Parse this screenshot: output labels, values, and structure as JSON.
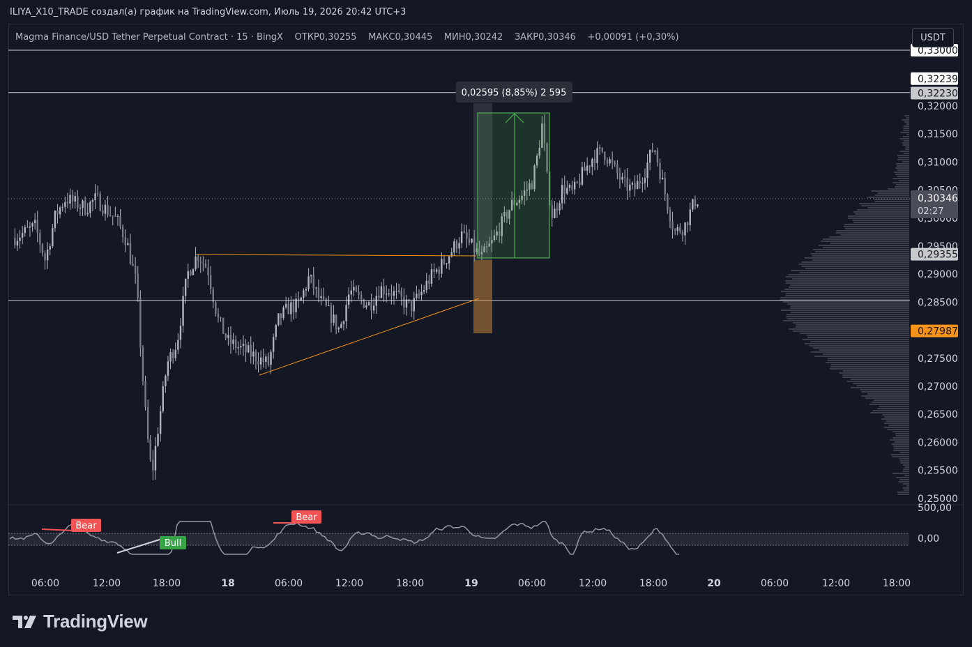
{
  "header": {
    "caption": "ILIYA_X10_TRADE создал(а) график на TradingView.com, Июль 19, 2026 20:42 UTC+3"
  },
  "legend": {
    "symbol": "Magma Finance/USD Tether Perpetual Contract · 15 · BingX",
    "open_label": "ОТКР",
    "open": "0,30255",
    "high_label": "МАКС",
    "high": "0,30445",
    "low_label": "МИН",
    "low": "0,30242",
    "close_label": "ЗАКР",
    "close": "0,30346",
    "change": "+0,00091 (+0,30%)"
  },
  "toolbar": {
    "currency": "USDT"
  },
  "price_axis": {
    "ticks": [
      "0,32000",
      "0,31500",
      "0,31000",
      "0,30500",
      "0,30000",
      "0,29500",
      "0,29000",
      "0,28500",
      "0,28000",
      "0,27500",
      "0,27000",
      "0,26500",
      "0,26000",
      "0,25500",
      "0,25000"
    ],
    "labels": {
      "top_hidden": "0,33000",
      "line_a": "0,32239",
      "line_b": "0,32230",
      "last_price": "0,30346",
      "countdown": "02:27",
      "level_mid": "0,29355",
      "level_low": "0,27987"
    }
  },
  "time_axis": {
    "ticks": [
      "06:00",
      "12:00",
      "18:00",
      "18",
      "06:00",
      "12:00",
      "18:00",
      "19",
      "06:00",
      "12:00",
      "18:00",
      "20",
      "06:00",
      "12:00",
      "18:00"
    ]
  },
  "measure": {
    "label": "0,02595 (8,85%) 2 595"
  },
  "indicator": {
    "axis_top": "500,00",
    "axis_zero": "0,00",
    "bear_label": "Bear",
    "bull_label": "Bull"
  },
  "brand": {
    "name": "TradingView"
  },
  "colors": {
    "background": "#131722",
    "candle": "#b2b5be",
    "orange": "#f7931a",
    "green": "#4caf50",
    "bear": "#f05454",
    "bull": "#37a547"
  },
  "chart_data": {
    "type": "candlestick",
    "symbol": "Magma Finance/USD Tether Perpetual Contract",
    "timeframe": "15",
    "ylim": [
      0.25,
      0.33
    ],
    "horizontal_levels": [
      0.32239,
      0.3223,
      0.30346,
      0.29355,
      0.2853,
      0.27987
    ],
    "close_path": [
      [
        "17 03:00",
        0.2965
      ],
      [
        "17 05:00",
        0.2985
      ],
      [
        "17 06:00",
        0.2925
      ],
      [
        "17 07:00",
        0.3005
      ],
      [
        "17 08:00",
        0.3035
      ],
      [
        "17 10:00",
        0.3018
      ],
      [
        "17 11:00",
        0.3035
      ],
      [
        "17 12:00",
        0.3015
      ],
      [
        "17 13:00",
        0.2998
      ],
      [
        "17 14:00",
        0.296
      ],
      [
        "17 15:00",
        0.288
      ],
      [
        "17 15:30",
        0.274
      ],
      [
        "17 16:00",
        0.262
      ],
      [
        "17 16:30",
        0.254
      ],
      [
        "17 17:00",
        0.261
      ],
      [
        "17 18:00",
        0.274
      ],
      [
        "17 19:00",
        0.278
      ],
      [
        "17 20:00",
        0.29
      ],
      [
        "17 21:00",
        0.2935
      ],
      [
        "17 22:00",
        0.291
      ],
      [
        "17 23:00",
        0.282
      ],
      [
        "18 00:00",
        0.278
      ],
      [
        "18 02:00",
        0.276
      ],
      [
        "18 03:00",
        0.275
      ],
      [
        "18 04:00",
        0.274
      ],
      [
        "18 05:00",
        0.282
      ],
      [
        "18 06:00",
        0.284
      ],
      [
        "18 07:00",
        0.2845
      ],
      [
        "18 08:00",
        0.2895
      ],
      [
        "18 09:00",
        0.2855
      ],
      [
        "18 10:00",
        0.283
      ],
      [
        "18 11:00",
        0.28
      ],
      [
        "18 12:00",
        0.287
      ],
      [
        "18 13:00",
        0.2855
      ],
      [
        "18 14:00",
        0.2845
      ],
      [
        "18 15:00",
        0.2875
      ],
      [
        "18 16:00",
        0.287
      ],
      [
        "18 17:00",
        0.2855
      ],
      [
        "18 18:00",
        0.284
      ],
      [
        "18 19:00",
        0.2865
      ],
      [
        "18 20:00",
        0.2895
      ],
      [
        "18 21:00",
        0.2915
      ],
      [
        "18 22:00",
        0.294
      ],
      [
        "18 23:00",
        0.297
      ],
      [
        "19 00:00",
        0.295
      ],
      [
        "19 01:00",
        0.293
      ],
      [
        "19 02:00",
        0.2955
      ],
      [
        "19 03:00",
        0.299
      ],
      [
        "19 04:00",
        0.3025
      ],
      [
        "19 05:00",
        0.304
      ],
      [
        "19 06:00",
        0.3065
      ],
      [
        "19 06:30",
        0.311
      ],
      [
        "19 07:00",
        0.317
      ],
      [
        "19 07:30",
        0.306
      ],
      [
        "19 08:00",
        0.3
      ],
      [
        "19 09:00",
        0.3055
      ],
      [
        "19 10:00",
        0.3045
      ],
      [
        "19 11:00",
        0.308
      ],
      [
        "19 12:00",
        0.311
      ],
      [
        "19 13:00",
        0.312
      ],
      [
        "19 14:00",
        0.309
      ],
      [
        "19 15:00",
        0.306
      ],
      [
        "19 16:00",
        0.305
      ],
      [
        "19 17:00",
        0.308
      ],
      [
        "19 18:00",
        0.313
      ],
      [
        "19 19:00",
        0.305
      ],
      [
        "19 20:00",
        0.2975
      ],
      [
        "19 21:00",
        0.2985
      ],
      [
        "19 22:00",
        0.303
      ],
      [
        "19 22:30",
        0.30346
      ]
    ]
  }
}
